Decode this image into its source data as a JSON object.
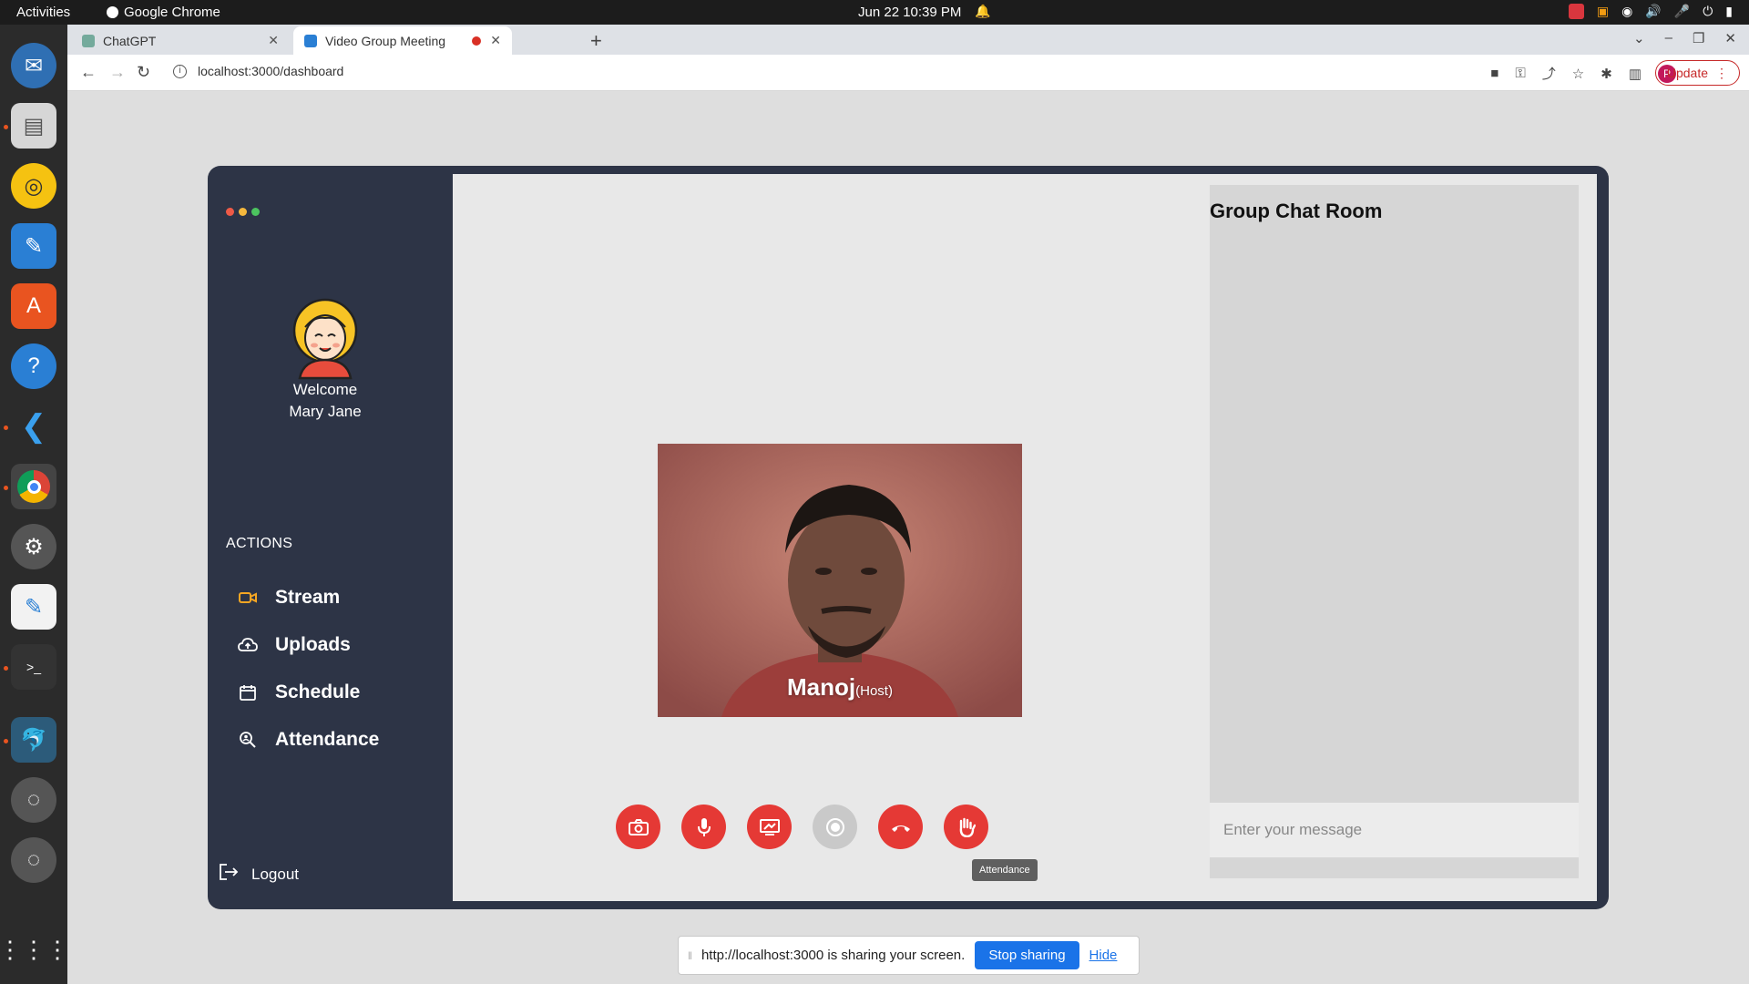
{
  "os": {
    "activities": "Activities",
    "app_name": "Google Chrome",
    "clock": "Jun 22  10:39 PM"
  },
  "browser": {
    "tabs": [
      {
        "title": "ChatGPT"
      },
      {
        "title": "Video Group Meeting"
      }
    ],
    "url": "localhost:3000/dashboard",
    "update_label": "Update"
  },
  "sidebar": {
    "welcome_line1": "Welcome",
    "welcome_line2": "Mary Jane",
    "actions_title": "ACTIONS",
    "items": [
      {
        "label": "Stream",
        "icon": "video-camera-icon"
      },
      {
        "label": "Uploads",
        "icon": "cloud-upload-icon"
      },
      {
        "label": "Schedule",
        "icon": "calendar-icon"
      },
      {
        "label": "Attendance",
        "icon": "attendance-search-icon"
      }
    ],
    "logout": "Logout"
  },
  "video": {
    "name": "Manoj",
    "role": "(Host)"
  },
  "controls": {
    "tooltip": "Attendance"
  },
  "chat": {
    "title": "Group Chat Room",
    "placeholder": "Enter your message"
  },
  "share_bar": {
    "message": "http://localhost:3000 is sharing your screen.",
    "stop_label": "Stop sharing",
    "hide_label": "Hide"
  },
  "colors": {
    "accent_red": "#e53935",
    "sidebar_bg": "#2d3446",
    "stream_icon": "#f5a623",
    "chrome_blue": "#1a73e8"
  }
}
